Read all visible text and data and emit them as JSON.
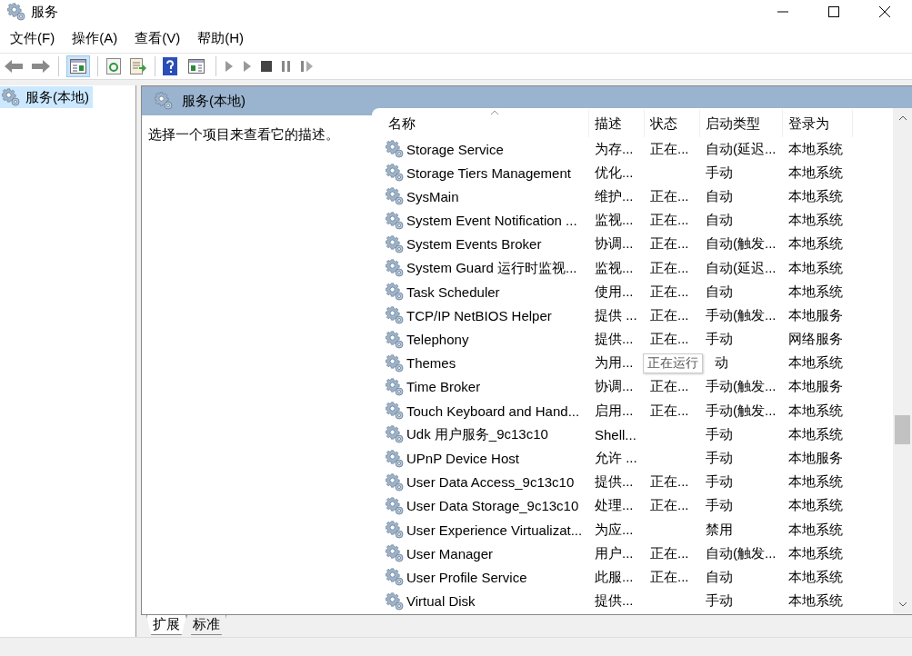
{
  "window": {
    "title": "服务"
  },
  "menu": [
    "文件(F)",
    "操作(A)",
    "查看(V)",
    "帮助(H)"
  ],
  "tree": [
    {
      "label": "服务(本地)",
      "selected": true
    }
  ],
  "panel": {
    "title": "服务(本地)",
    "description": "选择一个项目来查看它的描述。"
  },
  "table": {
    "columns": [
      "名称",
      "描述",
      "状态",
      "启动类型",
      "登录为"
    ],
    "rows": [
      {
        "name": "Storage Service",
        "description": "为存...",
        "status": "正在...",
        "startup": "自动(延迟...",
        "logon": "本地系统"
      },
      {
        "name": "Storage Tiers Management",
        "description": "优化...",
        "startup": "手动",
        "logon": "本地系统"
      },
      {
        "name": "SysMain",
        "description": "维护...",
        "status": "正在...",
        "startup": "自动",
        "logon": "本地系统"
      },
      {
        "name": "System Event Notification ...",
        "description": "监视...",
        "status": "正在...",
        "startup": "自动",
        "logon": "本地系统"
      },
      {
        "name": "System Events Broker",
        "description": "协调...",
        "status": "正在...",
        "startup": "自动(触发...",
        "logon": "本地系统"
      },
      {
        "name": "System Guard 运行时监视...",
        "description": "监视...",
        "status": "正在...",
        "startup": "自动(延迟...",
        "logon": "本地系统"
      },
      {
        "name": "Task Scheduler",
        "description": "使用...",
        "status": "正在...",
        "startup": "自动",
        "logon": "本地系统"
      },
      {
        "name": "TCP/IP NetBIOS Helper",
        "description": "提供 ...",
        "status": "正在...",
        "startup": "手动(触发...",
        "logon": "本地服务"
      },
      {
        "name": "Telephony",
        "description": "提供...",
        "status": "正在...",
        "startup": "手动",
        "logon": "网络服务"
      },
      {
        "name": "Themes",
        "description": "为用...",
        "startup": "动",
        "logon": "本地系统",
        "tooltip": "正在运行"
      },
      {
        "name": "Time Broker",
        "description": "协调...",
        "status": "正在...",
        "startup": "手动(触发...",
        "logon": "本地服务"
      },
      {
        "name": "Touch Keyboard and Hand...",
        "description": "启用...",
        "status": "正在...",
        "startup": "手动(触发...",
        "logon": "本地系统"
      },
      {
        "name": "Udk 用户服务_9c13c10",
        "description": "Shell...",
        "startup": "手动",
        "logon": "本地系统"
      },
      {
        "name": "UPnP Device Host",
        "description": "允许 ...",
        "startup": "手动",
        "logon": "本地服务"
      },
      {
        "name": "User Data Access_9c13c10",
        "description": "提供...",
        "status": "正在...",
        "startup": "手动",
        "logon": "本地系统"
      },
      {
        "name": "User Data Storage_9c13c10",
        "description": "处理...",
        "status": "正在...",
        "startup": "手动",
        "logon": "本地系统"
      },
      {
        "name": "User Experience Virtualizat...",
        "description": "为应...",
        "startup": "禁用",
        "logon": "本地系统"
      },
      {
        "name": "User Manager",
        "description": "用户...",
        "status": "正在...",
        "startup": "自动(触发...",
        "logon": "本地系统"
      },
      {
        "name": "User Profile Service",
        "description": "此服...",
        "status": "正在...",
        "startup": "自动",
        "logon": "本地系统"
      },
      {
        "name": "Virtual Disk",
        "description": "提供...",
        "startup": "手动",
        "logon": "本地系统"
      }
    ]
  },
  "tabs": [
    {
      "label": "扩展",
      "selected": true
    },
    {
      "label": "标准",
      "selected": false
    }
  ]
}
